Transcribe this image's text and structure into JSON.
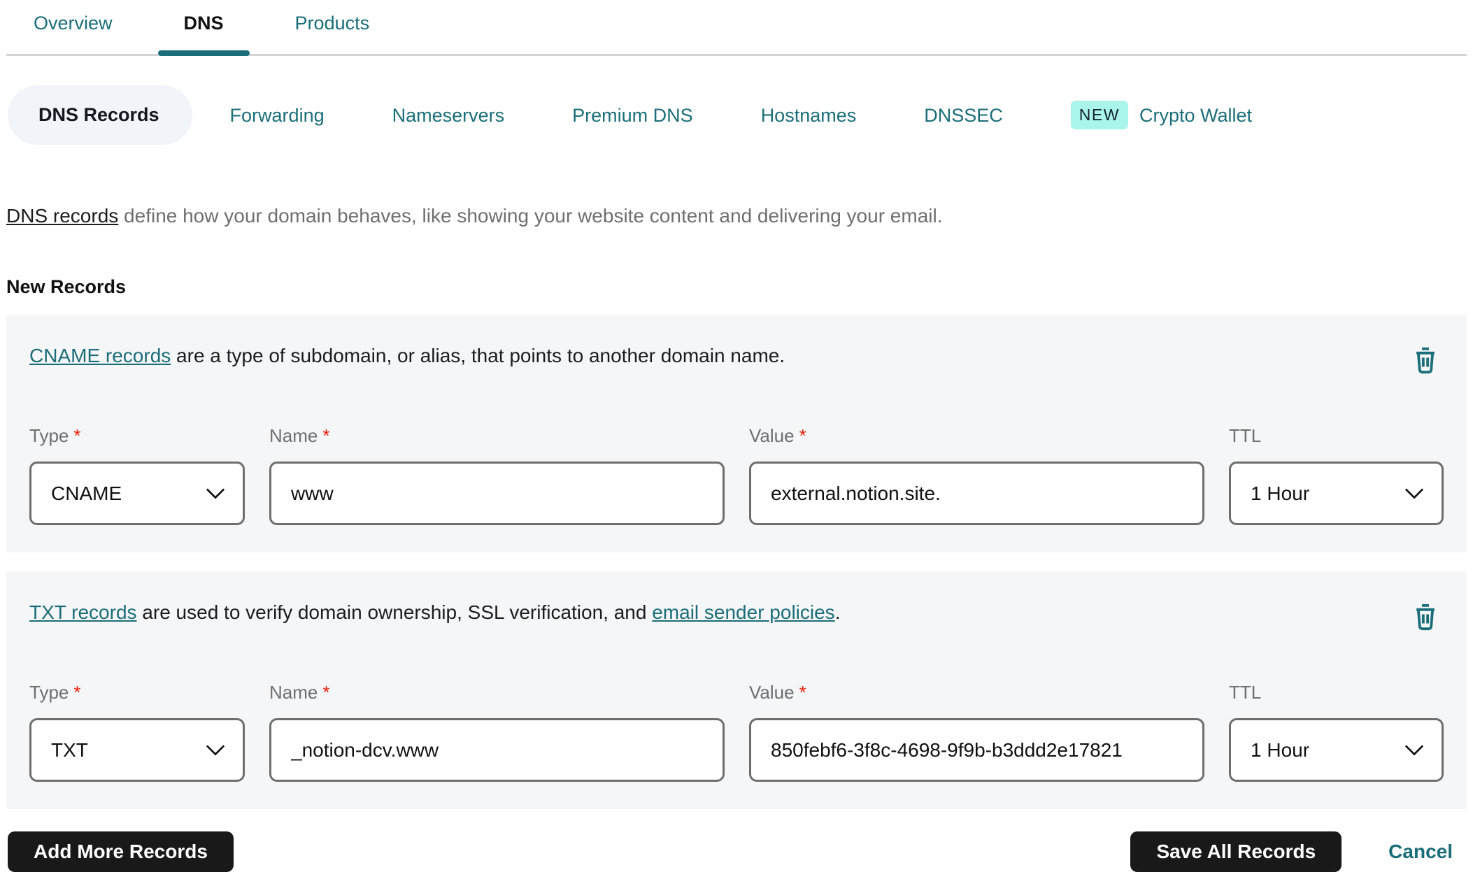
{
  "tabs": {
    "active": "DNS",
    "items": [
      {
        "label": "Overview"
      },
      {
        "label": "DNS"
      },
      {
        "label": "Products"
      }
    ]
  },
  "subnav": {
    "active": "DNS Records",
    "items": [
      "DNS Records",
      "Forwarding",
      "Nameservers",
      "Premium DNS",
      "Hostnames",
      "DNSSEC",
      "Crypto Wallet"
    ],
    "new_badge": "NEW"
  },
  "intro": {
    "link_text": "DNS records",
    "text": " define how your domain behaves, like showing your website content and delivering your email."
  },
  "section_heading": "New Records",
  "field_labels": {
    "type": "Type",
    "name": "Name",
    "value": "Value",
    "ttl": "TTL",
    "required_mark": "*"
  },
  "records": [
    {
      "description": {
        "link": "CNAME records",
        "text": " are a type of subdomain, or alias, that points to another domain name.",
        "link2": "",
        "tail": ""
      },
      "type": "CNAME",
      "name": "www",
      "value": "external.notion.site.",
      "ttl": "1 Hour"
    },
    {
      "description": {
        "link": "TXT records",
        "text": " are used to verify domain ownership, SSL verification, and ",
        "link2": "email sender policies",
        "tail": "."
      },
      "type": "TXT",
      "name": "_notion-dcv.www",
      "value": "850febf6-3f8c-4698-9f9b-b3ddd2e17821",
      "ttl": "1 Hour"
    }
  ],
  "actions": {
    "add": "Add More Records",
    "save": "Save All Records",
    "cancel": "Cancel"
  },
  "icons": {
    "delete": "trash-icon",
    "select_arrow": "chevron-down-icon"
  },
  "colors": {
    "teal_accent": "#1b6e79",
    "new_badge_bg": "#a9f5ec",
    "required_asterisk": "#e8220f",
    "dark_button_bg": "#191919",
    "card_bg": "#f5f6f7",
    "active_pill_bg": "#f1f4f8"
  }
}
